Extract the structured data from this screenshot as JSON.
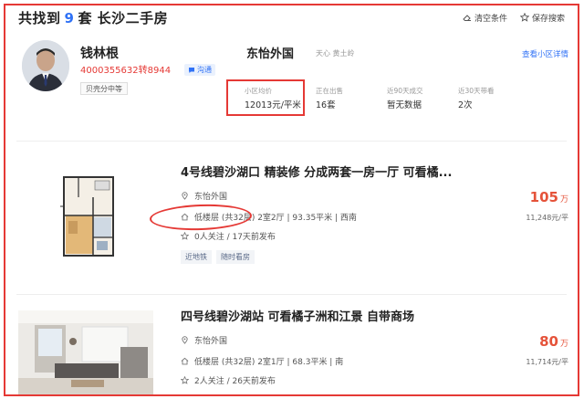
{
  "header": {
    "prefix": "共找到",
    "count": "9",
    "suffix": "套 长沙二手房",
    "clear_label": "清空条件",
    "save_label": "保存搜索"
  },
  "agent": {
    "name": "钱林根",
    "phone": "4000355632转8944",
    "chat_label": "沟通",
    "tag": "贝壳分中等"
  },
  "community": {
    "name": "东怡外国",
    "location": "天心 黄土岭",
    "link_label": "查看小区详情",
    "stats": [
      {
        "label": "小区均价",
        "value": "12013元/平米"
      },
      {
        "label": "正在出售",
        "value": "16套"
      },
      {
        "label": "近90天成交",
        "value": "暂无数据"
      },
      {
        "label": "近30天带看",
        "value": "2次"
      }
    ]
  },
  "listings": [
    {
      "title": "4号线碧沙湖口 精装修 分成两套一房一厅 可看橘...",
      "community": "东怡外国",
      "layout": "低楼层 (共32层) 2室2厅 | 93.35平米 | 西南",
      "followers": "0人关注 / 17天前发布",
      "tags": [
        "近地铁",
        "随时看房"
      ],
      "price": "105",
      "price_unit": "万",
      "unit_price": "11,248元/平"
    },
    {
      "title": "四号线碧沙湖站 可看橘子洲和江景 自带商场",
      "community": "东怡外国",
      "layout": "低楼层 (共32层) 2室1厅 | 68.3平米 | 南",
      "followers": "2人关注 / 26天前发布",
      "tags": [],
      "price": "80",
      "price_unit": "万",
      "unit_price": "11,714元/平"
    }
  ],
  "colors": {
    "accent_blue": "#3072f6",
    "price_red": "#e5533a",
    "annotation_red": "#e53935"
  }
}
